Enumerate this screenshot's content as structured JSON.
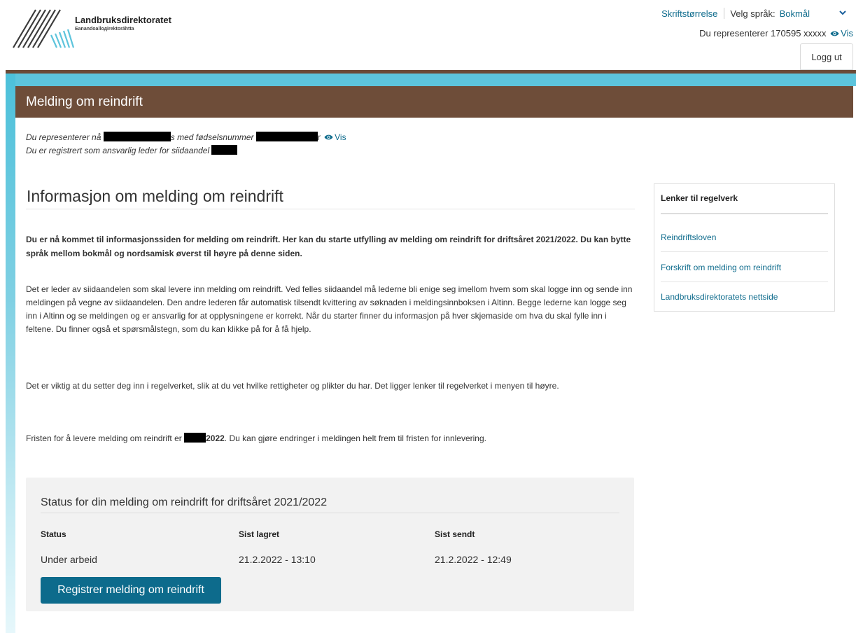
{
  "brand": {
    "name": "Landbruksdirektoratet",
    "subname": "Eanandoalloдirektoráhtta",
    "brown": "#6e4d39",
    "cyan": "#5dc4dc",
    "link": "#0f6c8d"
  },
  "header": {
    "font_size_link": "Skriftstørrelse",
    "language_label": "Velg språk:",
    "language_selected": "Bokmål",
    "represent_text": "Du representerer 170595 xxxxx",
    "vis_label": "Vis",
    "logout_label": "Logg ut"
  },
  "panel": {
    "title": "Melding om reindrift",
    "rep_prefix": "Du representerer nå",
    "rep_mid": "s med fødselsnummer",
    "rep_suffix": "r",
    "vis_label": "Vis",
    "registered_text": "Du er registrert som ansvarlig leder for siidaandel"
  },
  "main": {
    "heading": "Informasjon om melding om reindrift",
    "lead": "Du er nå kommet til informasjonssiden for melding om reindrift. Her kan du starte utfylling av melding om reindrift for driftsåret 2021/2022. Du kan bytte språk mellom bokmål og nordsamisk øverst til høyre på denne siden.",
    "p1": "Det er leder av siidaandelen som skal levere inn melding om reindrift. Ved felles siidaandel må lederne bli enige seg imellom hvem som skal logge inn og sende inn meldingen på vegne av siidaandelen. Den andre lederen får automatisk tilsendt kvittering av søknaden i meldingsinnboksen i Altinn. Begge lederne kan logge seg inn i Altinn og se meldingen og er ansvarlig for at opplysningene er korrekt. Når du starter finner du informasjon på hver skjemaside om hva du skal fylle inn i feltene. Du finner også et spørsmålstegn, som du kan klikke på for å få hjelp.",
    "p2": "Det er viktig at du setter deg inn i regelverket, slik at du vet hvilke rettigheter og plikter du har. Det ligger lenker til regelverket i menyen til høyre.",
    "p3_prefix": "Fristen for å levere melding om reindrift er",
    "p3_year": "2022",
    "p3_suffix": ". Du kan gjøre endringer i meldingen helt frem til fristen for innlevering."
  },
  "sidebar": {
    "title": "Lenker til regelverk",
    "links": [
      "Reindriftsloven",
      "Forskrift om melding om reindrift",
      "Landbruksdirektoratets nettside"
    ]
  },
  "status": {
    "title": "Status for din melding om reindrift for driftsåret 2021/2022",
    "headers": [
      "Status",
      "Sist lagret",
      "Sist sendt"
    ],
    "values": [
      "Under arbeid",
      "21.2.2022 - 13:10",
      "21.2.2022 - 12:49"
    ],
    "button_label": "Registrer melding om reindrift"
  }
}
